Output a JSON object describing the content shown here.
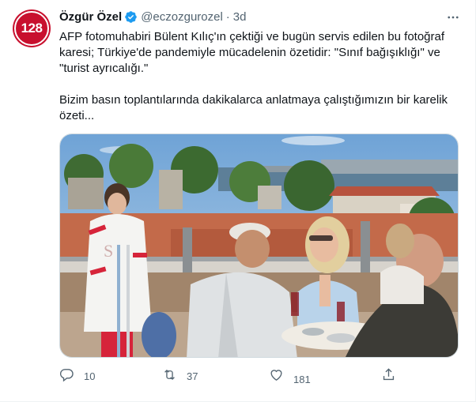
{
  "author": {
    "display_name": "Özgür Özel",
    "handle": "@eczozgurozel",
    "separator": "·",
    "time": "3d",
    "avatar_text": "128",
    "avatar_color": "#c8102e"
  },
  "tweet": {
    "paragraph1": "AFP fotomuhabiri Bülent Kılıç'ın çektiği ve bugün servis edilen bu fotoğraf karesi; Türkiye'de pandemiyle mücadelenin özetidir: \"Sınıf bağışıklığı\" ve \"turist ayrıcalığı.\"",
    "paragraph2": "Bizim basın toplantılarında dakikalarca anlatmaya çalıştığımızın bir karelik özeti..."
  },
  "actions": {
    "reply_count": "10",
    "retweet_count": "37",
    "like_count": "181"
  },
  "colors": {
    "verified": "#1d9bf0",
    "text": "#0f1419",
    "secondary": "#536471"
  },
  "icons": [
    "verified-badge-icon",
    "more-icon",
    "reply-icon",
    "retweet-icon",
    "like-icon",
    "share-icon"
  ]
}
